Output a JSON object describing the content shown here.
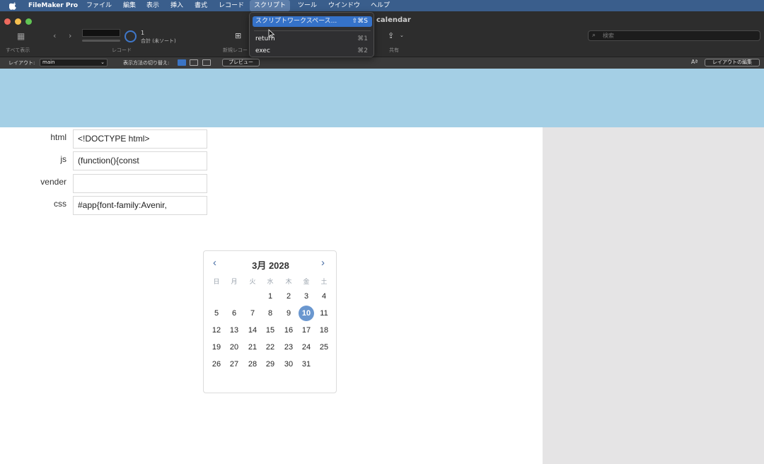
{
  "menubar": {
    "app_name": "FileMaker Pro",
    "items": [
      "ファイル",
      "編集",
      "表示",
      "挿入",
      "書式",
      "レコード",
      "スクリプト",
      "ツール",
      "ウインドウ",
      "ヘルプ"
    ]
  },
  "window": {
    "title": "calendar"
  },
  "toolbar": {
    "show_all_label": "すべて表示",
    "records_label": "レコード",
    "new_record_label": "新規レコー",
    "share_label": "共有",
    "record_count": "1",
    "record_total": "合計 (未ソート)",
    "search_placeholder": "検索"
  },
  "layoutbar": {
    "layout_label": "レイアウト:",
    "layout_value": "main",
    "view_as_label": "表示方法の切り替え:",
    "preview_label": "プレビュー",
    "edit_layout_label": "レイアウトの編集",
    "font_icon_label": "Aª"
  },
  "script_menu": {
    "items": [
      {
        "label": "スクリプトワークスペース...",
        "shortcut": "⇧⌘S"
      },
      {
        "label": "return",
        "shortcut": "⌘1"
      },
      {
        "label": "exec",
        "shortcut": "⌘2"
      }
    ]
  },
  "fields": [
    {
      "label": "html",
      "value": "<!DOCTYPE html>"
    },
    {
      "label": "js",
      "value": "(function(){const"
    },
    {
      "label": "vender",
      "value": ""
    },
    {
      "label": "css",
      "value": "#app{font-family:Avenir,"
    }
  ],
  "calendar": {
    "title": "3月 2028",
    "prev": "‹",
    "next": "›",
    "weekdays": [
      "日",
      "月",
      "火",
      "水",
      "木",
      "金",
      "土"
    ],
    "weeks": [
      [
        "",
        "",
        "",
        "1",
        "2",
        "3",
        "4"
      ],
      [
        "5",
        "6",
        "7",
        "8",
        "9",
        "10",
        "11"
      ],
      [
        "12",
        "13",
        "14",
        "15",
        "16",
        "17",
        "18"
      ],
      [
        "19",
        "20",
        "21",
        "22",
        "23",
        "24",
        "25"
      ],
      [
        "26",
        "27",
        "28",
        "29",
        "30",
        "31",
        ""
      ]
    ],
    "selected": "10"
  },
  "colors": {
    "menubar_bg": "#3a5e8c",
    "header_band": "#a4cfe5",
    "selected_day": "#6a97cf",
    "menu_highlight": "#3572c9"
  }
}
